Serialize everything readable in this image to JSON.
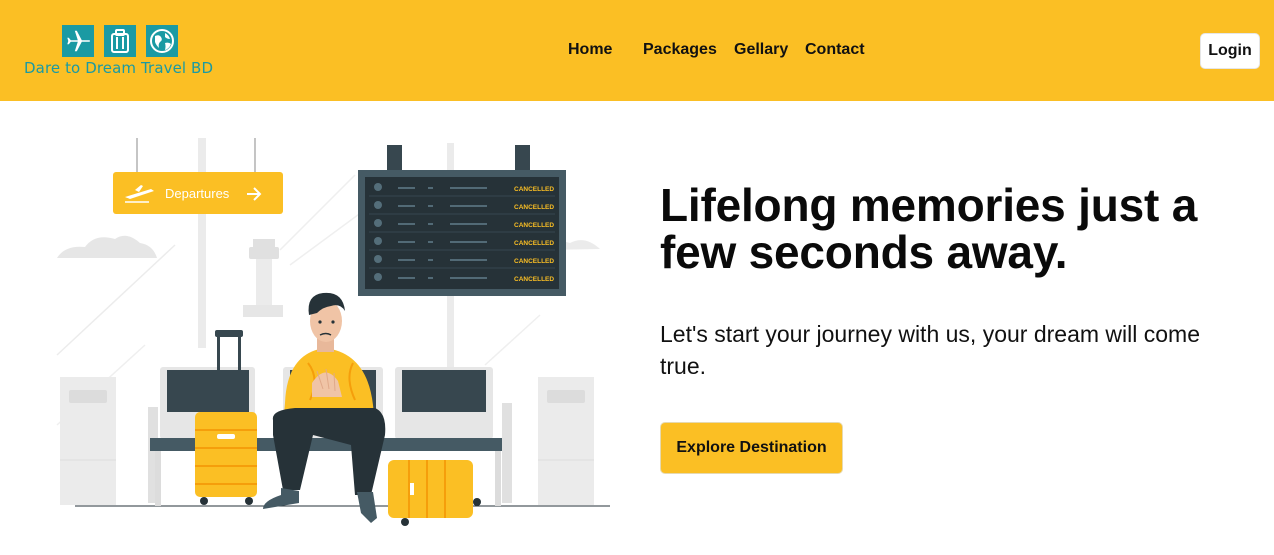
{
  "brand": {
    "name": "Dare to Dream Travel BD",
    "colors": {
      "primary": "#fbbf24",
      "logo": "#1a9aa3",
      "dark": "#37474f"
    },
    "icons": [
      "airplane-icon",
      "suitcase-icon",
      "globe-icon"
    ]
  },
  "nav": {
    "home": "Home",
    "packages": "Packages",
    "gallery": "Gellary",
    "contact": "Contact",
    "login": "Login"
  },
  "hero": {
    "title": "Lifelong memories just a few seconds away.",
    "subtitle": "Let's start your journey with us, your dream will come true.",
    "cta": "Explore Destination",
    "illustration": {
      "sign_text": "Departures",
      "board_status": "CANCELLED"
    }
  }
}
